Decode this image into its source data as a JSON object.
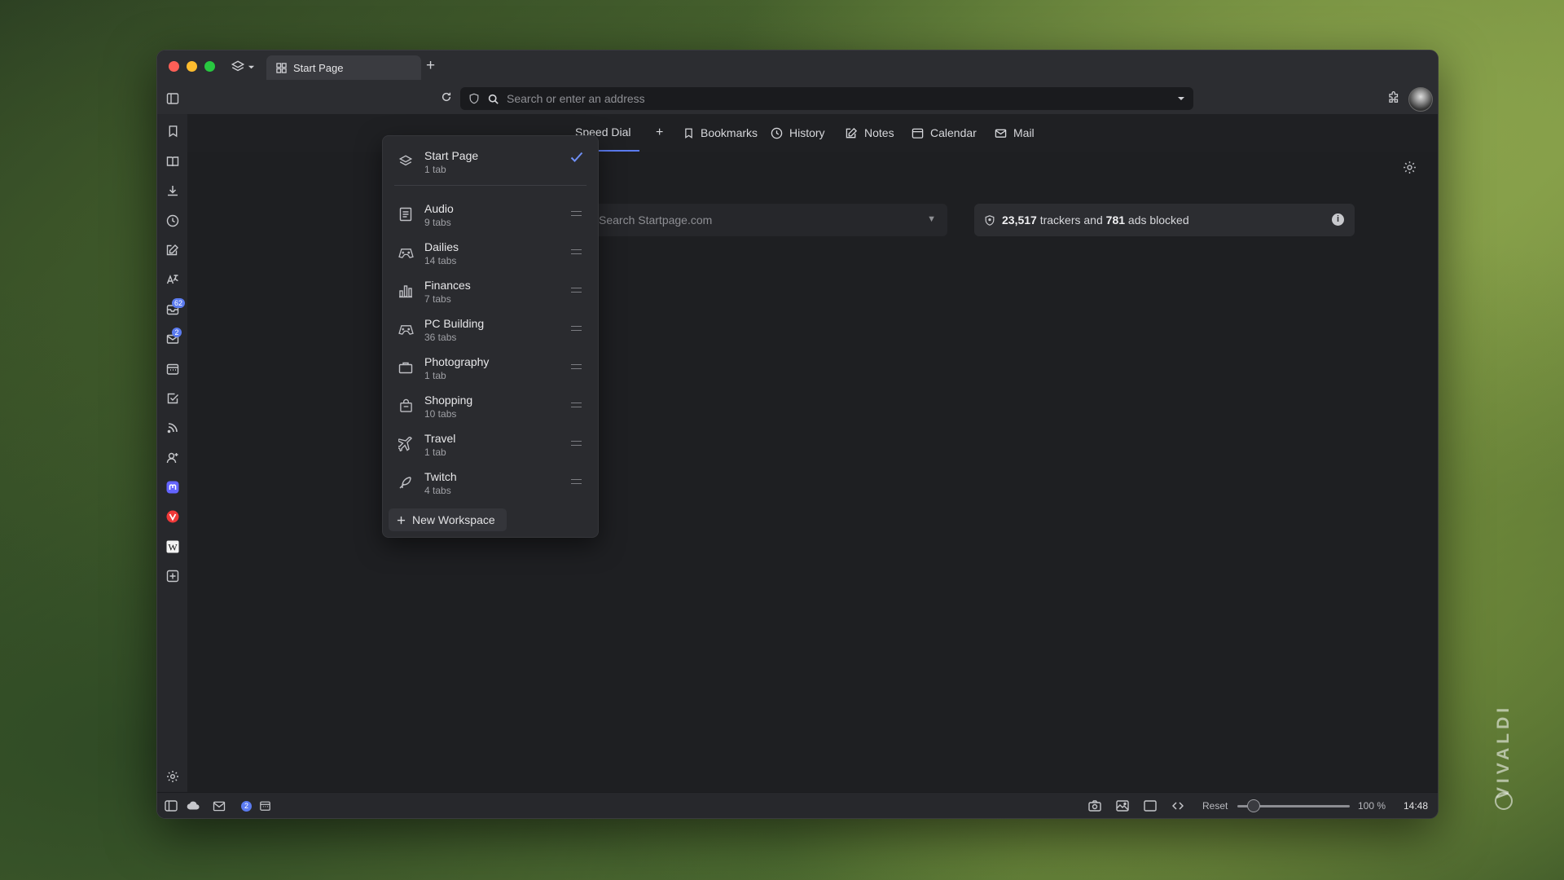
{
  "watermark": {
    "brand": "VIVALDI"
  },
  "tab": {
    "title": "Start Page"
  },
  "address": {
    "placeholder": "Search or enter an address"
  },
  "nav": {
    "speed_dial": "Speed Dial",
    "add": "+",
    "bookmarks": "Bookmarks",
    "history": "History",
    "notes": "Notes",
    "calendar": "Calendar",
    "mail": "Mail"
  },
  "sidepanel": {
    "badges": {
      "feeds": "62",
      "mail": "2"
    }
  },
  "content": {
    "search_placeholder": "Search Startpage.com",
    "trackers_count": "23,517",
    "trackers_text": " trackers and ",
    "ads_count": "781",
    "ads_text": " ads blocked"
  },
  "workspaces": {
    "current": {
      "name": "Start Page",
      "count": "1 tab"
    },
    "items": [
      {
        "name": "Audio",
        "count": "9 tabs",
        "icon": "document-icon"
      },
      {
        "name": "Dailies",
        "count": "14 tabs",
        "icon": "gamepad-icon"
      },
      {
        "name": "Finances",
        "count": "7 tabs",
        "icon": "bar-chart-icon"
      },
      {
        "name": "PC Building",
        "count": "36 tabs",
        "icon": "gamepad-icon"
      },
      {
        "name": "Photography",
        "count": "1 tab",
        "icon": "briefcase-icon"
      },
      {
        "name": "Shopping",
        "count": "10 tabs",
        "icon": "shopping-bag-icon"
      },
      {
        "name": "Travel",
        "count": "1 tab",
        "icon": "plane-icon"
      },
      {
        "name": "Twitch",
        "count": "4 tabs",
        "icon": "feather-icon"
      }
    ],
    "new_label": "New Workspace"
  },
  "statusbar": {
    "mail_badge": "2",
    "reset": "Reset",
    "zoom": "100 %",
    "time": "14:48"
  },
  "colors": {
    "accent": "#5b7bf0",
    "window_bg": "#1e1f22"
  }
}
